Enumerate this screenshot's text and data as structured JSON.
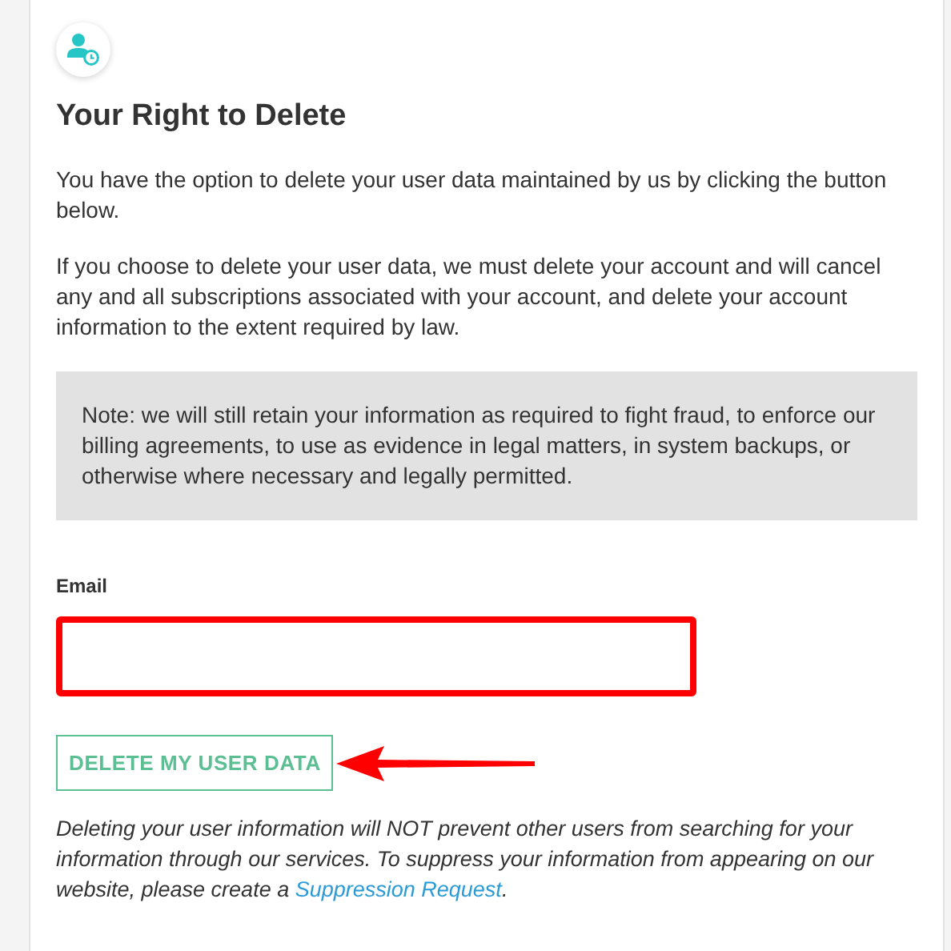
{
  "title": "Your Right to Delete",
  "paragraphs": [
    "You have the option to delete your user data maintained by us by clicking the button below.",
    "If you choose to delete your user data, we must delete your account and will cancel any and all subscriptions associated with your account, and delete your account information to the extent required by law."
  ],
  "note": "Note: we will still retain your information as required to fight fraud, to enforce our billing agreements, to use as evidence in legal matters, in system backups, or otherwise where necessary and legally permitted.",
  "email_field": {
    "label": "Email",
    "highlighted": true
  },
  "delete_button": {
    "label": "DELETE MY USER DATA",
    "arrow": true
  },
  "footer": {
    "before": "Deleting your user information will NOT prevent other users from searching for your information through our services. To suppress your information from appearing on our website, please create a ",
    "link": "Suppression Request",
    "after": "."
  }
}
